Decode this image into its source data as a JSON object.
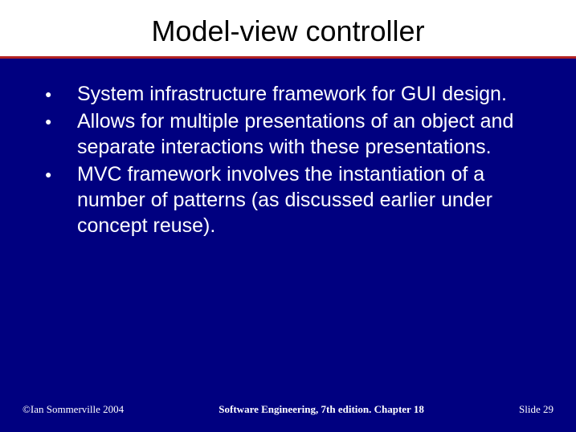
{
  "title": "Model-view controller",
  "bullets": [
    "System infrastructure framework for GUI design.",
    "Allows for multiple presentations of an object and separate interactions with these presentations.",
    "MVC framework involves the instantiation of a number of patterns (as discussed earlier under concept reuse)."
  ],
  "footer": {
    "left": "©Ian Sommerville 2004",
    "center": "Software Engineering, 7th edition. Chapter 18",
    "right_label": "Slide",
    "right_number": "29"
  }
}
